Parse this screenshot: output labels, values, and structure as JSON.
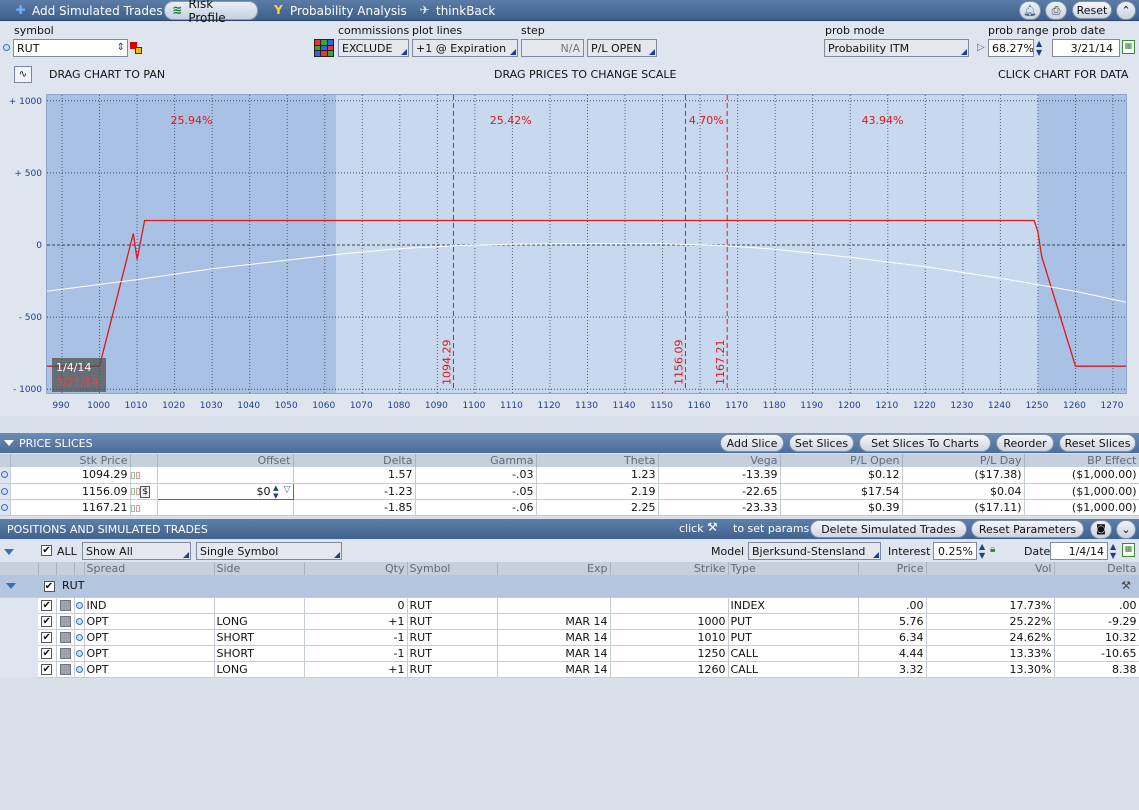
{
  "toolbar": {
    "tabs": [
      {
        "label": "Add Simulated Trades",
        "icon": "plus-icon"
      },
      {
        "label": "Risk Profile",
        "icon": "risk-profile-icon"
      },
      {
        "label": "Probability Analysis",
        "icon": "probability-icon"
      },
      {
        "label": "thinkBack",
        "icon": "thinkback-icon"
      }
    ],
    "reset_label": "Reset"
  },
  "controls": {
    "symbol_label": "symbol",
    "symbol_value": "RUT",
    "commissions_label": "commissions",
    "commissions_value": "EXCLUDE",
    "plot_lines_label": "plot lines",
    "plot_lines_value": "+1 @ Expiration",
    "step_label": "step",
    "step_value": "N/A",
    "pl_mode_value": "P/L OPEN",
    "prob_mode_label": "prob mode",
    "prob_mode_value": "Probability ITM",
    "prob_range_label": "prob range",
    "prob_range_value": "68.27%",
    "prob_date_label": "prob date",
    "prob_date_value": "3/21/14"
  },
  "chart_bar": {
    "left": "DRAG CHART TO PAN",
    "center": "DRAG PRICES TO CHANGE SCALE",
    "right": "CLICK CHART FOR DATA"
  },
  "chart_data": {
    "type": "line",
    "x_ticks": [
      990,
      1000,
      1010,
      1020,
      1030,
      1040,
      1050,
      1060,
      1070,
      1080,
      1090,
      1100,
      1110,
      1120,
      1130,
      1140,
      1150,
      1160,
      1170,
      1180,
      1190,
      1200,
      1210,
      1220,
      1230,
      1240,
      1250,
      1260,
      1270
    ],
    "y_ticks": [
      {
        "value": 1000,
        "label": "+ 1000"
      },
      {
        "value": 500,
        "label": "+ 500"
      },
      {
        "value": 0,
        "label": "0"
      },
      {
        "value": -500,
        "label": "- 500"
      },
      {
        "value": -1000,
        "label": "- 1000"
      }
    ],
    "xlim": [
      986,
      1274
    ],
    "ylim": [
      -1040,
      1040
    ],
    "series": [
      {
        "name": "3/21/14",
        "color": "#e01818",
        "x": [
          986,
          1000,
          1009,
          1010,
          1012,
          1249,
          1250,
          1251,
          1260,
          1274
        ],
        "y": [
          -840,
          -840,
          80,
          -100,
          170,
          170,
          90,
          -80,
          -840,
          -840
        ]
      },
      {
        "name": "1/4/14",
        "color": "#ffffff",
        "x": [
          986,
          1010,
          1030,
          1050,
          1065,
          1080,
          1094,
          1110,
          1130,
          1150,
          1167,
          1180,
          1200,
          1220,
          1240,
          1260,
          1274
        ],
        "y": [
          -320,
          -240,
          -165,
          -105,
          -60,
          -25,
          -5,
          5,
          10,
          8,
          -5,
          -30,
          -85,
          -150,
          -230,
          -320,
          -400
        ]
      }
    ],
    "prob_zones": [
      {
        "from": 986,
        "to": 1063,
        "label": "25.94%"
      },
      {
        "from": 1063,
        "to": 1156.09,
        "label": "25.42%"
      },
      {
        "from": 1156.09,
        "to": 1167.21,
        "label": "4.70%"
      },
      {
        "from": 1167.21,
        "to": 1250,
        "label": "43.94%"
      }
    ],
    "prob_shading": [
      {
        "from": 986,
        "to": 1063,
        "shade": "dark"
      },
      {
        "from": 1063,
        "to": 1250,
        "shade": "light"
      },
      {
        "from": 1250,
        "to": 1274,
        "shade": "dark"
      }
    ],
    "prob_line_x": 1094.29,
    "slice_lines": [
      1094.29,
      1156.09,
      1167.21
    ],
    "slice_labels": [
      "1094.29",
      "1156.09",
      "1167.21"
    ],
    "legend": {
      "placement": "bottom-left",
      "entries": [
        "1/4/14",
        "3/21/14"
      ]
    }
  },
  "price_slices": {
    "title": "PRICE SLICES",
    "buttons": [
      "Add Slice",
      "Set Slices",
      "Set Slices To Charts",
      "Reorder",
      "Reset Slices"
    ],
    "columns": [
      "Stk Price",
      "Offset",
      "Delta",
      "Gamma",
      "Theta",
      "Vega",
      "P/L Open",
      "P/L Day",
      "BP Effect"
    ],
    "rows": [
      {
        "price": "1094.29",
        "offset": "",
        "delta": "1.57",
        "gamma": "-.03",
        "theta": "1.23",
        "vega": "-13.39",
        "pl_open": "$0.12",
        "pl_day": "($17.38)",
        "bp": "($1,000.00)"
      },
      {
        "price": "1156.09",
        "offset": "$0",
        "delta": "-1.23",
        "gamma": "-.05",
        "theta": "2.19",
        "vega": "-22.65",
        "pl_open": "$17.54",
        "pl_day": "$0.04",
        "bp": "($1,000.00)"
      },
      {
        "price": "1167.21",
        "offset": "",
        "delta": "-1.85",
        "gamma": "-.06",
        "theta": "2.25",
        "vega": "-23.33",
        "pl_open": "$0.39",
        "pl_day": "($17.11)",
        "bp": "($1,000.00)"
      }
    ],
    "offset_dollar": "$"
  },
  "positions": {
    "title": "POSITIONS AND SIMULATED TRADES",
    "click_hint_pre": "click",
    "click_hint_post": "to set params",
    "delete_label": "Delete Simulated Trades",
    "reset_params_label": "Reset Parameters",
    "all_label": "ALL",
    "show_value": "Show All",
    "symbol_filter_value": "Single Symbol",
    "model_label": "Model",
    "model_value": "Bjerksund-Stensland",
    "interest_label": "Interest",
    "interest_value": "0.25%",
    "date_label": "Date",
    "date_value": "1/4/14",
    "columns": [
      "Spread",
      "Side",
      "Qty",
      "Symbol",
      "Exp",
      "Strike",
      "Type",
      "Price",
      "Vol",
      "Delta"
    ],
    "group_label": "RUT",
    "rows": [
      {
        "spread": "IND",
        "side": "",
        "qty": "0",
        "symbol": "RUT",
        "exp": "",
        "strike": "",
        "type": "INDEX",
        "price": ".00",
        "vol": "17.73%",
        "delta": ".00"
      },
      {
        "spread": "OPT",
        "side": "LONG",
        "qty": "+1",
        "symbol": "RUT",
        "exp": "MAR 14",
        "strike": "1000",
        "type": "PUT",
        "price": "5.76",
        "vol": "25.22%",
        "delta": "-9.29"
      },
      {
        "spread": "OPT",
        "side": "SHORT",
        "qty": "-1",
        "symbol": "RUT",
        "exp": "MAR 14",
        "strike": "1010",
        "type": "PUT",
        "price": "6.34",
        "vol": "24.62%",
        "delta": "10.32"
      },
      {
        "spread": "OPT",
        "side": "SHORT",
        "qty": "-1",
        "symbol": "RUT",
        "exp": "MAR 14",
        "strike": "1250",
        "type": "CALL",
        "price": "4.44",
        "vol": "13.33%",
        "delta": "-10.65"
      },
      {
        "spread": "OPT",
        "side": "LONG",
        "qty": "+1",
        "symbol": "RUT",
        "exp": "MAR 14",
        "strike": "1260",
        "type": "CALL",
        "price": "3.32",
        "vol": "13.30%",
        "delta": "8.38"
      }
    ]
  },
  "colors": {
    "accent": "#4b6d99",
    "loss_line": "#e01818",
    "theo_line": "#ffffff",
    "chart_bg": "#c4d6ee"
  }
}
